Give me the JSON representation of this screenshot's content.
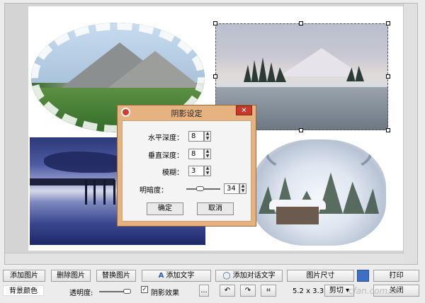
{
  "dialog": {
    "title": "阴影设定",
    "close_label": "✕",
    "fields": [
      {
        "label": "水平深度：",
        "value": "8"
      },
      {
        "label": "垂直深度：",
        "value": "8"
      },
      {
        "label": "模糊：",
        "value": "3"
      },
      {
        "label": "明暗度：",
        "value": "34"
      }
    ],
    "ok_label": "确定",
    "cancel_label": "取消"
  },
  "toolbar": {
    "add_image": "添加图片",
    "delete_image": "删除图片",
    "replace_image": "替换图片",
    "add_text": "添加文字",
    "add_text_icon": "A",
    "add_dialog_text": "添加对话文字",
    "image_size": "图片尺寸",
    "print": "打印",
    "background_color": "背景颜色",
    "transparency": "透明度:",
    "shadow_effect": "阴影效果",
    "more": "...",
    "size_readout": "5.2 x 3.3",
    "crop_option": "剪切",
    "close": "关闭",
    "watermark": "cfan.com.cn"
  },
  "colors": {
    "dialog_frame": "#e6b27f",
    "close_button": "#c9382b",
    "canvas": "#ffffff"
  },
  "icons": {
    "save": "floppy-icon",
    "rotate_left": "rotate-left-icon",
    "rotate_right": "rotate-right-icon",
    "crop": "crop-icon"
  }
}
